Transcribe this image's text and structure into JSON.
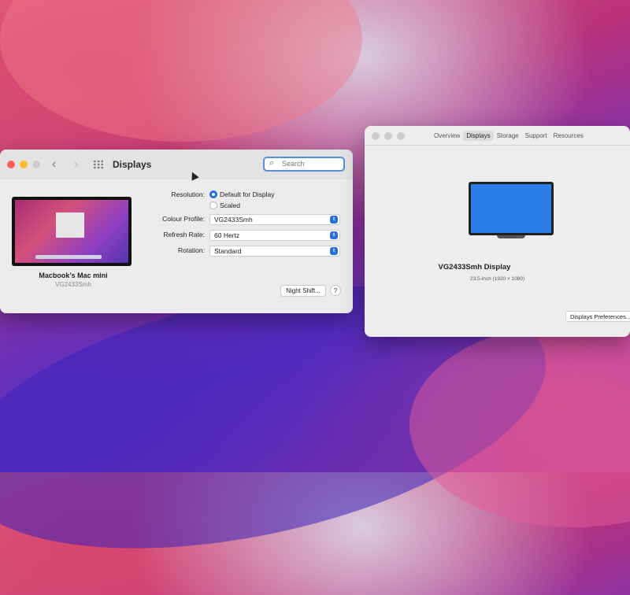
{
  "displays_window": {
    "title": "Displays",
    "search": {
      "placeholder": "Search"
    },
    "nav": {
      "back": "‹",
      "forward": "›"
    },
    "device": {
      "name": "Macbook’s Mac mini",
      "model": "VG2433Smh"
    },
    "settings": {
      "resolution_label": "Resolution:",
      "resolution_options": [
        "Default for Display",
        "Scaled"
      ],
      "resolution_selected": "Default for Display",
      "colour_profile_label": "Colour Profile:",
      "colour_profile_value": "VG2433Smh",
      "refresh_rate_label": "Refresh Rate:",
      "refresh_rate_value": "60 Hertz",
      "rotation_label": "Rotation:",
      "rotation_value": "Standard"
    },
    "night_shift_button": "Night Shift...",
    "help_button": "?"
  },
  "about_window": {
    "tabs": [
      "Overview",
      "Displays",
      "Storage",
      "Support",
      "Resources"
    ],
    "active_tab": "Displays",
    "display_name": "VG2433Smh Display",
    "display_size": "23.5-inch (1920 × 1080)",
    "prefs_button": "Displays Preferences..."
  },
  "colors": {
    "close": "#ff5f57",
    "minimize": "#febc2e",
    "zoom": "#28c840",
    "inactive_dot": "#cdcdcd",
    "accent": "#1f6fe0"
  }
}
